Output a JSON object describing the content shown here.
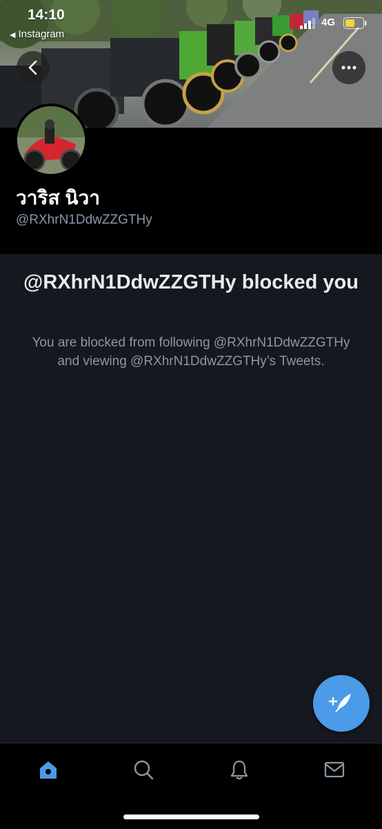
{
  "status_bar": {
    "time": "14:10",
    "back_app": "Instagram",
    "network": "4G"
  },
  "nav": {
    "back_icon": "chevron-left-icon",
    "more_icon": "ellipsis-icon"
  },
  "profile": {
    "display_name": "วาริส นิวา",
    "handle": "@RXhrN1DdwZZGTHy"
  },
  "blocked": {
    "title": "@RXhrN1DdwZZGTHy blocked you",
    "description": "You are blocked from following @RXhrN1DdwZZGTHy and viewing @RXhrN1DdwZZGTHy’s Tweets."
  },
  "compose": {
    "icon": "compose-tweet-icon"
  },
  "tabbar": {
    "items": [
      {
        "name": "home",
        "icon": "home-icon",
        "active": true
      },
      {
        "name": "search",
        "icon": "search-icon",
        "active": false
      },
      {
        "name": "notifications",
        "icon": "bell-icon",
        "active": false
      },
      {
        "name": "messages",
        "icon": "mail-icon",
        "active": false
      }
    ]
  },
  "colors": {
    "accent": "#4b9be8",
    "background": "#15181e",
    "secondary_text": "#8b98a5"
  }
}
